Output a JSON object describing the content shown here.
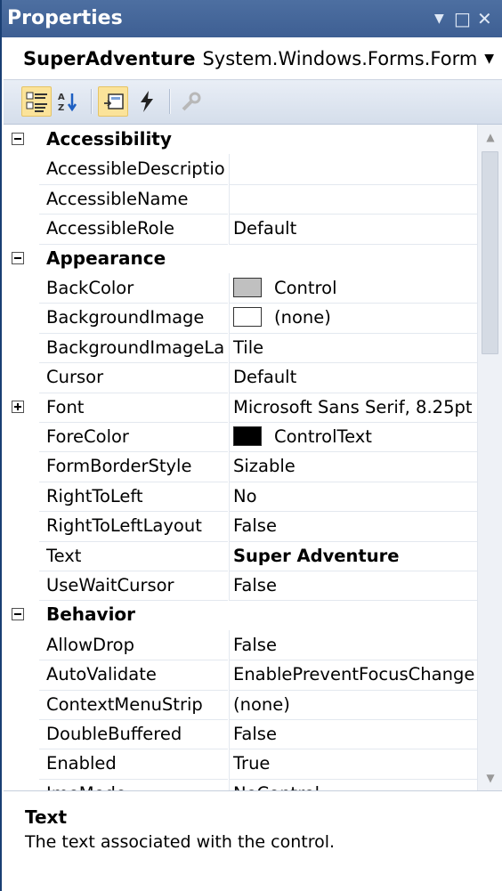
{
  "title": "Properties",
  "object_selector": {
    "name": "SuperAdventure",
    "type": "System.Windows.Forms.Form"
  },
  "toolbar": {
    "buttons": [
      {
        "icon": "categorized-icon",
        "active": true
      },
      {
        "icon": "alphabetical-icon",
        "active": false
      },
      {
        "icon": "properties-icon",
        "active": true
      },
      {
        "icon": "events-icon",
        "active": false
      },
      {
        "icon": "property-pages-icon",
        "active": false
      }
    ]
  },
  "grid": {
    "categories": [
      {
        "name": "Accessibility",
        "expanded": true,
        "properties": [
          {
            "name": "AccessibleDescriptio",
            "value": ""
          },
          {
            "name": "AccessibleName",
            "value": ""
          },
          {
            "name": "AccessibleRole",
            "value": "Default"
          }
        ]
      },
      {
        "name": "Appearance",
        "expanded": true,
        "properties": [
          {
            "name": "BackColor",
            "value": "Control",
            "swatch": "#c0c0c0"
          },
          {
            "name": "BackgroundImage",
            "value": "(none)",
            "swatch": "#ffffff"
          },
          {
            "name": "BackgroundImageLa",
            "value": "Tile"
          },
          {
            "name": "Cursor",
            "value": "Default"
          },
          {
            "name": "Font",
            "value": "Microsoft Sans Serif, 8.25pt",
            "expandable": true
          },
          {
            "name": "ForeColor",
            "value": "ControlText",
            "swatch": "#000000"
          },
          {
            "name": "FormBorderStyle",
            "value": "Sizable"
          },
          {
            "name": "RightToLeft",
            "value": "No"
          },
          {
            "name": "RightToLeftLayout",
            "value": "False"
          },
          {
            "name": "Text",
            "value": "Super Adventure",
            "bold": true
          },
          {
            "name": "UseWaitCursor",
            "value": "False"
          }
        ]
      },
      {
        "name": "Behavior",
        "expanded": true,
        "properties": [
          {
            "name": "AllowDrop",
            "value": "False"
          },
          {
            "name": "AutoValidate",
            "value": "EnablePreventFocusChange"
          },
          {
            "name": "ContextMenuStrip",
            "value": "(none)"
          },
          {
            "name": "DoubleBuffered",
            "value": "False"
          },
          {
            "name": "Enabled",
            "value": "True"
          },
          {
            "name": "ImeMode",
            "value": "NoControl"
          }
        ]
      }
    ]
  },
  "description": {
    "title": "Text",
    "text": "The text associated with the control."
  },
  "colors": {
    "title_bar": "#4466a0",
    "toolbar_active": "#fbe39a"
  }
}
